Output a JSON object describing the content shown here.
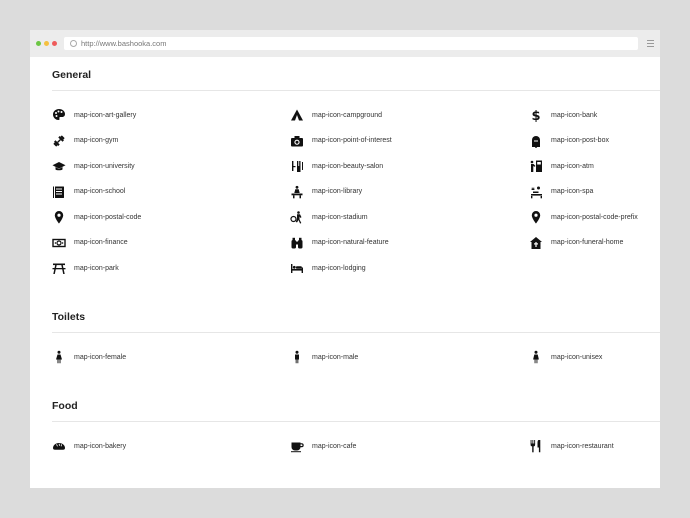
{
  "browser": {
    "url": "http://www.bashooka.com"
  },
  "sections": {
    "general": {
      "title": "General",
      "items": [
        {
          "label": "map-icon-art-gallery",
          "icon": "palette-icon"
        },
        {
          "label": "map-icon-campground",
          "icon": "tent-icon"
        },
        {
          "label": "map-icon-bank",
          "icon": "dollar-icon"
        },
        {
          "label": "map-icon-gym",
          "icon": "dumbbell-icon"
        },
        {
          "label": "map-icon-point-of-interest",
          "icon": "camera-icon"
        },
        {
          "label": "map-icon-post-box",
          "icon": "mailbox-icon"
        },
        {
          "label": "map-icon-university",
          "icon": "graduation-cap-icon"
        },
        {
          "label": "map-icon-beauty-salon",
          "icon": "beauty-icon"
        },
        {
          "label": "map-icon-atm",
          "icon": "atm-icon"
        },
        {
          "label": "map-icon-school",
          "icon": "notebook-icon"
        },
        {
          "label": "map-icon-library",
          "icon": "library-icon"
        },
        {
          "label": "map-icon-spa",
          "icon": "spa-icon"
        },
        {
          "label": "map-icon-postal-code",
          "icon": "pin-icon"
        },
        {
          "label": "map-icon-stadium",
          "icon": "stadium-icon"
        },
        {
          "label": "map-icon-postal-code-prefix",
          "icon": "pin-icon"
        },
        {
          "label": "map-icon-finance",
          "icon": "banknote-icon"
        },
        {
          "label": "map-icon-natural-feature",
          "icon": "binoculars-icon"
        },
        {
          "label": "map-icon-funeral-home",
          "icon": "funeral-home-icon"
        },
        {
          "label": "map-icon-park",
          "icon": "picnic-table-icon"
        },
        {
          "label": "map-icon-lodging",
          "icon": "bed-icon"
        }
      ]
    },
    "toilets": {
      "title": "Toilets",
      "items": [
        {
          "label": "map-icon-female",
          "icon": "female-icon"
        },
        {
          "label": "map-icon-male",
          "icon": "male-icon"
        },
        {
          "label": "map-icon-unisex",
          "icon": "unisex-icon"
        }
      ]
    },
    "food": {
      "title": "Food",
      "items": [
        {
          "label": "map-icon-bakery",
          "icon": "bread-icon"
        },
        {
          "label": "map-icon-cafe",
          "icon": "cup-icon"
        },
        {
          "label": "map-icon-restaurant",
          "icon": "cutlery-icon"
        }
      ]
    }
  }
}
